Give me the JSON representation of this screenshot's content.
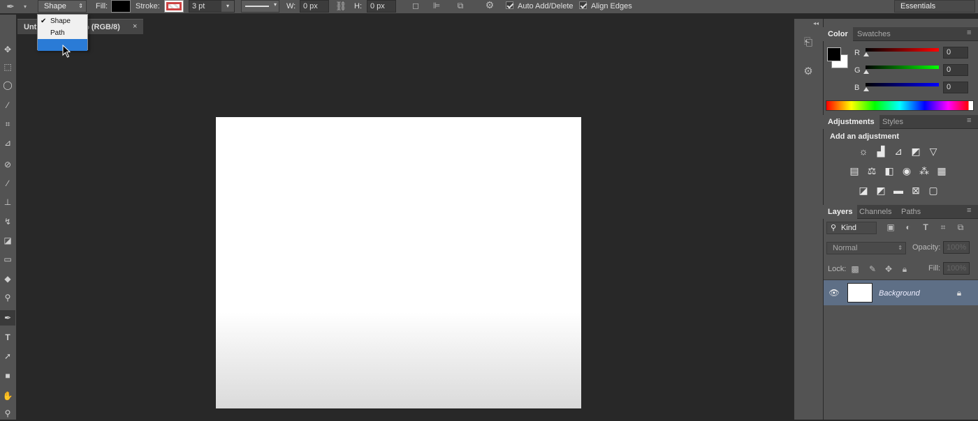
{
  "options_bar": {
    "mode_value": "Shape",
    "fill_label": "Fill:",
    "stroke_label": "Stroke:",
    "stroke_width": "3 pt",
    "w_label": "W:",
    "w_value": "0 px",
    "h_label": "H:",
    "h_value": "0 px",
    "auto_add_delete": "Auto Add/Delete",
    "align_edges": "Align Edges",
    "workspace": "Essentials"
  },
  "mode_menu": {
    "items": [
      {
        "label": "Shape",
        "checked": true
      },
      {
        "label": "Path",
        "checked": false
      },
      {
        "label": "",
        "checked": false,
        "highlighted": true
      }
    ]
  },
  "document": {
    "tab_left": "Unt",
    "tab_right": "% (RGB/8)",
    "close": "×"
  },
  "color_panel": {
    "tabs": [
      "Color",
      "Swatches"
    ],
    "r_label": "R",
    "g_label": "G",
    "b_label": "B",
    "r_value": "0",
    "g_value": "0",
    "b_value": "0",
    "foreground": "#000000",
    "background": "#ffffff"
  },
  "adjustments_panel": {
    "tabs": [
      "Adjustments",
      "Styles"
    ],
    "title": "Add an adjustment"
  },
  "layers_panel": {
    "tabs": [
      "Layers",
      "Channels",
      "Paths"
    ],
    "kind_filter": "Kind",
    "blend_mode": "Normal",
    "opacity_label": "Opacity:",
    "opacity_value": "100%",
    "lock_label": "Lock:",
    "fill_label": "Fill:",
    "fill_value": "100%",
    "layers": [
      {
        "name": "Background",
        "locked": true,
        "visible": true
      }
    ]
  },
  "colors": {
    "accent": "#2a7bd6",
    "selected_layer": "#5e6f86",
    "canvas": "#ffffff"
  }
}
